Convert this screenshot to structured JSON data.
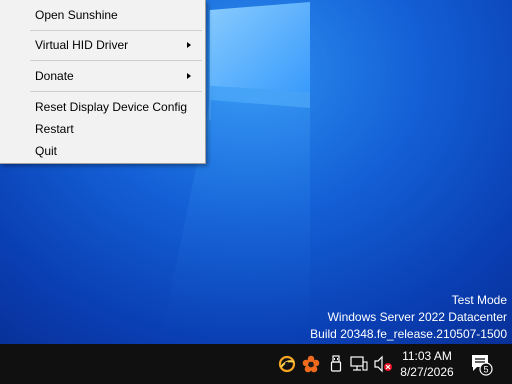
{
  "context_menu": {
    "items": [
      {
        "label": "Open Sunshine",
        "has_submenu": false
      },
      {
        "label": "Virtual HID Driver",
        "has_submenu": true
      },
      {
        "label": "Donate",
        "has_submenu": true
      },
      {
        "label": "Reset Display Device Config",
        "has_submenu": false
      },
      {
        "label": "Restart",
        "has_submenu": false
      },
      {
        "label": "Quit",
        "has_submenu": false
      }
    ]
  },
  "watermark": {
    "line1": "Test Mode",
    "line2": "Windows Server 2022 Datacenter",
    "line3": "Build 20348.fe_release.210507-1500"
  },
  "taskbar": {
    "tray_icons": [
      "sunshine-icon",
      "donate-flower-icon",
      "usb-icon",
      "network-icon",
      "volume-muted-icon"
    ],
    "clock": {
      "time": "11:03 AM",
      "date": "8/27/2026"
    },
    "notifications": {
      "icon": "action-center-icon",
      "count": "5"
    }
  },
  "colors": {
    "desktop_blue": "#1460d6",
    "taskbar": "#101010",
    "menu_bg": "#f2f2f2",
    "mute_red": "#e81123"
  }
}
